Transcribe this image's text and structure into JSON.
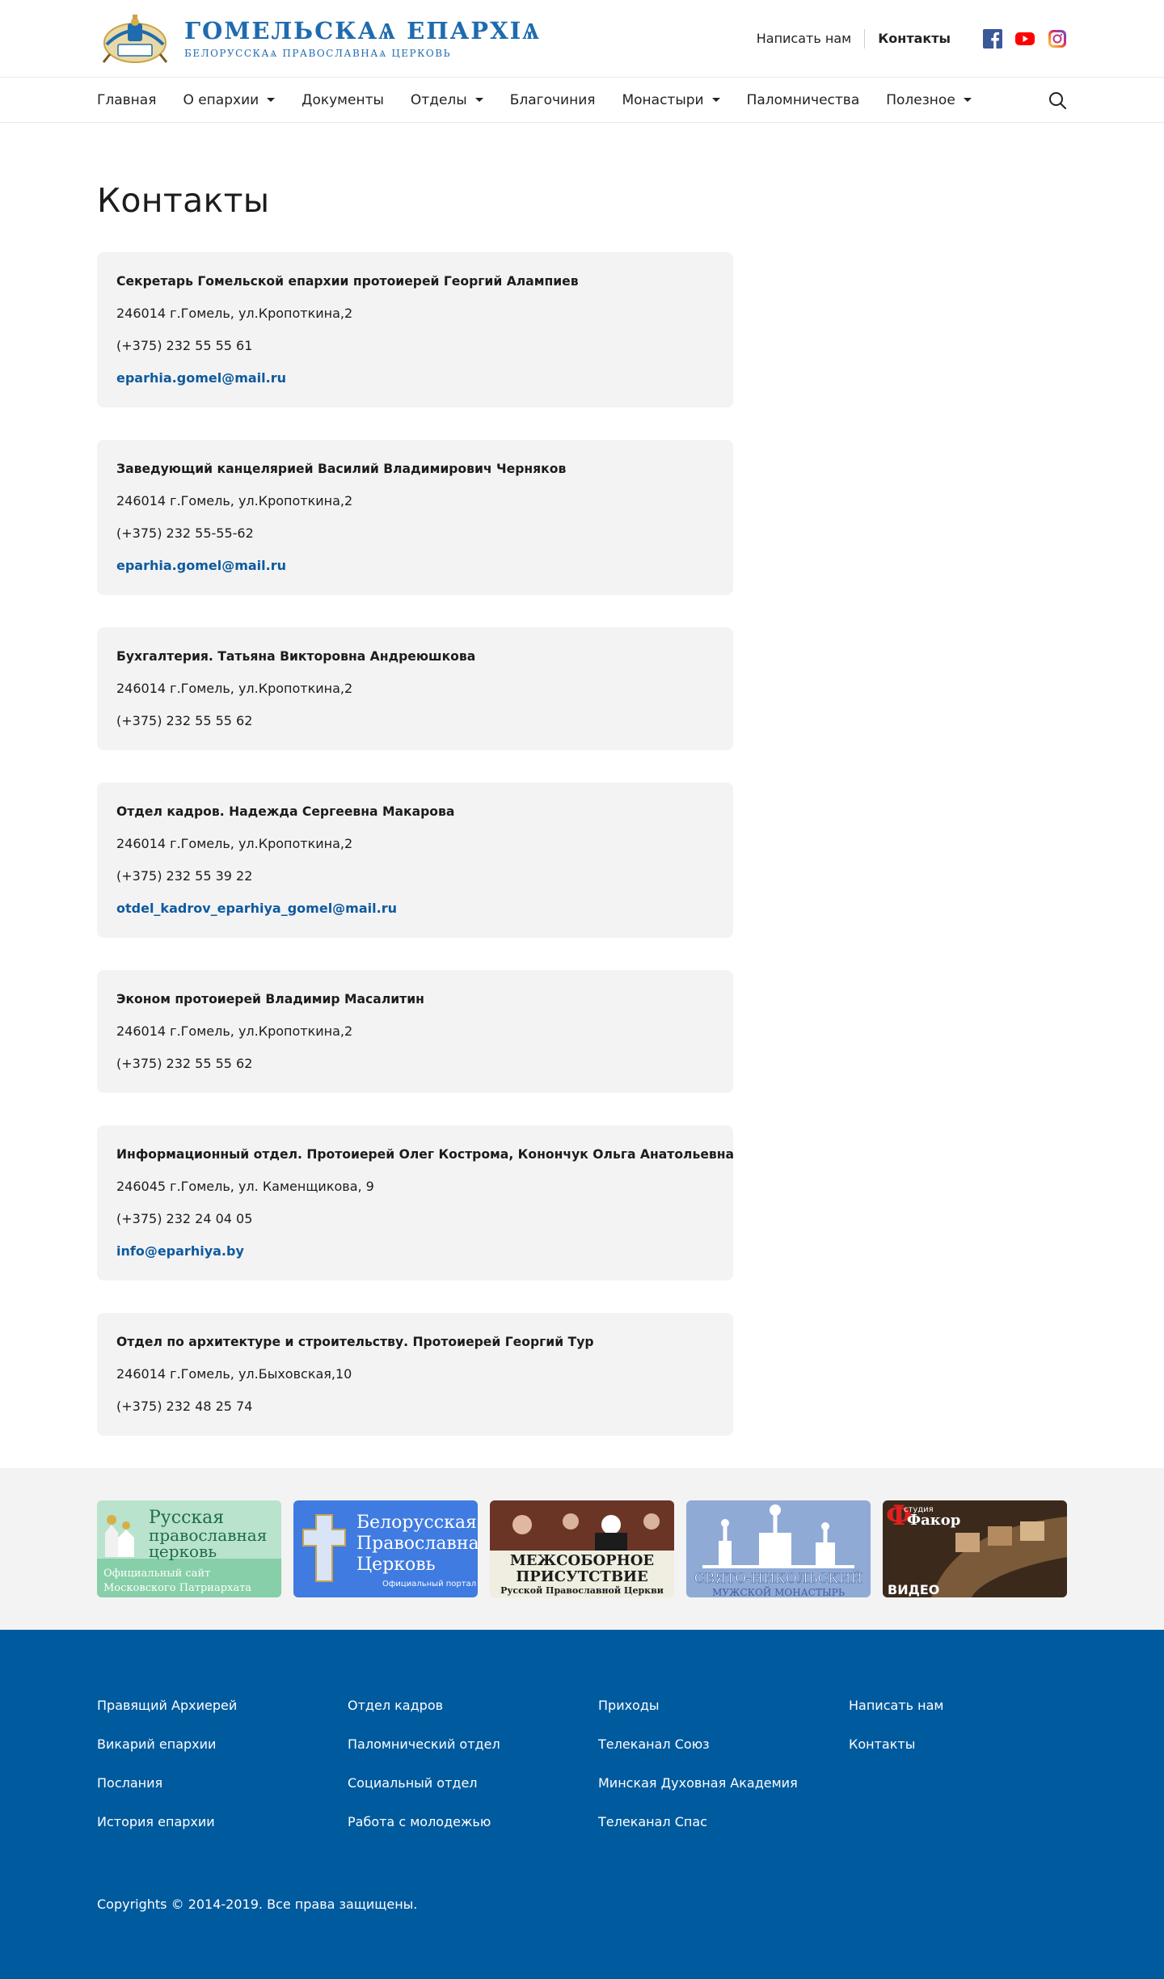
{
  "header": {
    "logo_title": "ГОМЕЛЬСКАѦ ЕПАРХІѦ",
    "logo_subtitle": "БЕЛОРУССКАѦ ПРАВОСЛАВНАѦ ЦЕРКОВЬ",
    "write_us": "Написать нам",
    "contacts": "Контакты",
    "socials": [
      "facebook-icon",
      "youtube-icon",
      "instagram-icon"
    ]
  },
  "nav": {
    "items": [
      {
        "label": "Главная",
        "dropdown": false
      },
      {
        "label": "О епархии",
        "dropdown": true
      },
      {
        "label": "Документы",
        "dropdown": false
      },
      {
        "label": "Отделы",
        "dropdown": true
      },
      {
        "label": "Благочиния",
        "dropdown": false
      },
      {
        "label": "Монастыри",
        "dropdown": true
      },
      {
        "label": "Паломничества",
        "dropdown": false
      },
      {
        "label": "Полезное",
        "dropdown": true
      }
    ],
    "search_icon": "search-icon"
  },
  "page": {
    "title": "Контакты",
    "contacts": [
      {
        "title": "Секретарь Гомельской епархии протоиерей Георгий Алампиев",
        "address": "246014 г.Гомель, ул.Кропоткина,2",
        "phone": "(+375) 232 55 55 61",
        "email": "eparhia.gomel@mail.ru"
      },
      {
        "title": "Заведующий канцелярией Василий Владимирович Черняков",
        "address": "246014 г.Гомель, ул.Кропоткина,2",
        "phone": "(+375) 232 55-55-62",
        "email": "eparhia.gomel@mail.ru"
      },
      {
        "title": "Бухгалтерия. Татьяна Викторовна Андреюшкова",
        "address": "246014 г.Гомель, ул.Кропоткина,2",
        "phone": "(+375) 232 55 55 62",
        "email": ""
      },
      {
        "title": "Отдел кадров. Надежда Сергеевна Макарова",
        "address": "246014 г.Гомель, ул.Кропоткина,2",
        "phone": "(+375) 232 55 39 22",
        "email": "otdel_kadrov_eparhiya_gomel@mail.ru"
      },
      {
        "title": "Эконом протоиерей Владимир Масалитин",
        "address": "246014 г.Гомель, ул.Кропоткина,2",
        "phone": "(+375) 232 55 55 62",
        "email": ""
      },
      {
        "title": "Информационный отдел. Протоиерей Олег Кострома, Конончук Ольга Анатольевна",
        "address": "246045 г.Гомель, ул. Каменщикова, 9",
        "phone": "(+375) 232 24 04 05",
        "email": "info@eparhiya.by"
      },
      {
        "title": "Отдел по архитектуре и строительству. Протоиерей Георгий Тур",
        "address": "246014 г.Гомель, ул.Быховская,10",
        "phone": "(+375) 232 48 25 74",
        "email": ""
      }
    ]
  },
  "banners": [
    {
      "line1": "Русская",
      "line2": "православная",
      "line3": "церковь",
      "line4": "Официальный сайт",
      "line5": "Московского Патриархата",
      "bg": "#7fc8a4"
    },
    {
      "line1": "Белорусская",
      "line2": "Православная",
      "line3": "Церковь",
      "line4": "Официальный портал",
      "bg": "#3d76d9"
    },
    {
      "line1": "МЕЖСОБОРНОЕ",
      "line2": "ПРИСУТСТВИЕ",
      "line3": "Русской Православной Церкви",
      "bg": "#efeee0"
    },
    {
      "line1": "СВЯТО-НИКОЛЬСКИЙ",
      "line2": "МУЖСКОЙ МОНАСТЫРЬ",
      "bg": "#8ea8d4"
    },
    {
      "line1": "студия",
      "line2": "Факор",
      "line3": "ВИДЕО",
      "bg": "#3b2a1c"
    }
  ],
  "footer": {
    "columns": [
      [
        "Правящий Архиерей",
        "Викарий епархии",
        "Послания",
        "История епархии"
      ],
      [
        "Отдел кадров",
        "Паломнический отдел",
        "Социальный отдел",
        "Работа с молодежью"
      ],
      [
        "Приходы",
        "Телеканал Союз",
        "Минская Духовная Академия",
        "Телеканал Спас"
      ],
      [
        "Написать нам",
        "Контакты"
      ]
    ],
    "copyright": "Copyrights © 2014-2019. Все права защищены."
  },
  "colors": {
    "accent": "#0e5a9e",
    "footer_bg": "#005a9e",
    "card_bg": "#f3f3f3",
    "logo_blue": "#1f6bb0"
  }
}
